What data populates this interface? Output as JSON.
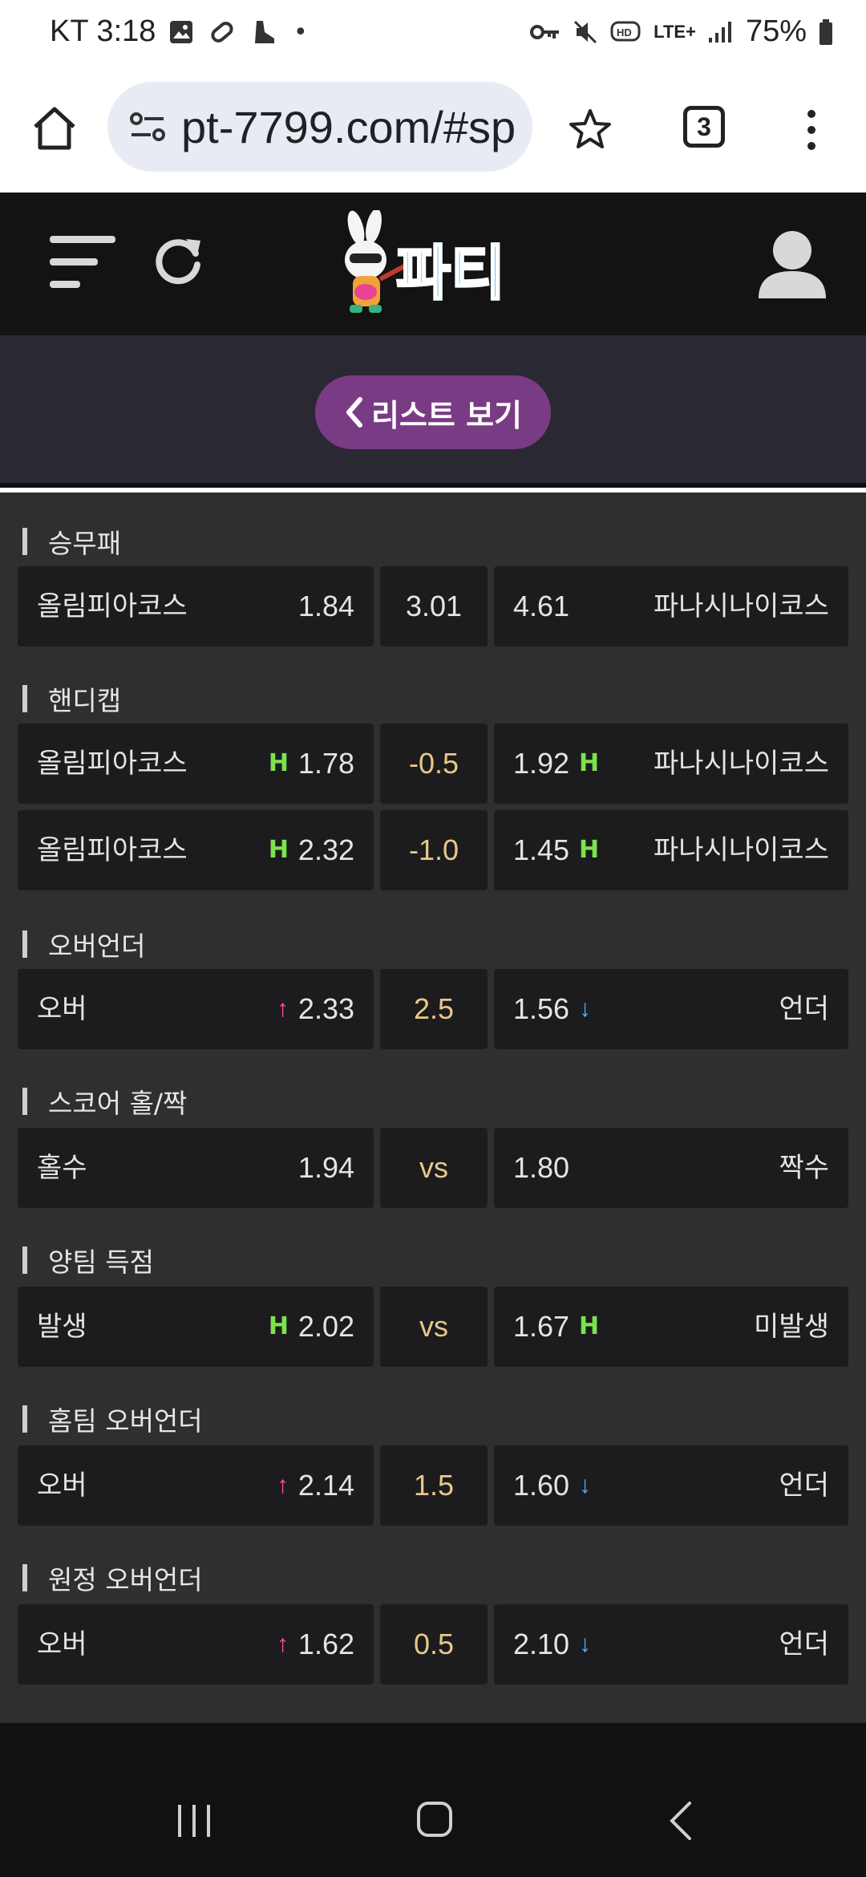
{
  "status_bar": {
    "carrier_time": "KT 3:18",
    "dot": "•",
    "network": "LTE+",
    "battery": "75%"
  },
  "browser": {
    "url": "pt-7799.com/#sp",
    "tab_count": "3"
  },
  "site": {
    "logo_text": "파티",
    "list_button": "리스트 보기"
  },
  "sections": [
    {
      "title": "승무패",
      "rows": [
        {
          "home_team": "올림피아코스",
          "home_mark": "",
          "home_odds": "1.84",
          "mid": "3.01",
          "away_odds": "4.61",
          "away_mark": "",
          "away_team": "파나시나이코스"
        }
      ]
    },
    {
      "title": "핸디캡",
      "rows": [
        {
          "home_team": "올림피아코스",
          "home_mark": "H",
          "home_odds": "1.78",
          "mid": "-0.5",
          "away_odds": "1.92",
          "away_mark": "H",
          "away_team": "파나시나이코스"
        },
        {
          "home_team": "올림피아코스",
          "home_mark": "H",
          "home_odds": "2.32",
          "mid": "-1.0",
          "away_odds": "1.45",
          "away_mark": "H",
          "away_team": "파나시나이코스"
        }
      ]
    },
    {
      "title": "오버언더",
      "rows": [
        {
          "home_team": "오버",
          "home_mark": "↑",
          "home_odds": "2.33",
          "mid": "2.5",
          "away_odds": "1.56",
          "away_mark": "↓",
          "away_team": "언더"
        }
      ]
    },
    {
      "title": "스코어 홀/짝",
      "rows": [
        {
          "home_team": "홀수",
          "home_mark": "",
          "home_odds": "1.94",
          "mid": "vs",
          "away_odds": "1.80",
          "away_mark": "",
          "away_team": "짝수"
        }
      ]
    },
    {
      "title": "양팀 득점",
      "rows": [
        {
          "home_team": "발생",
          "home_mark": "H",
          "home_odds": "2.02",
          "mid": "vs",
          "away_odds": "1.67",
          "away_mark": "H",
          "away_team": "미발생"
        }
      ]
    },
    {
      "title": "홈팀 오버언더",
      "rows": [
        {
          "home_team": "오버",
          "home_mark": "↑",
          "home_odds": "2.14",
          "mid": "1.5",
          "away_odds": "1.60",
          "away_mark": "↓",
          "away_team": "언더"
        }
      ]
    },
    {
      "title": "원정 오버언더",
      "rows": [
        {
          "home_team": "오버",
          "home_mark": "↑",
          "home_odds": "1.62",
          "mid": "0.5",
          "away_odds": "2.10",
          "away_mark": "↓",
          "away_team": "언더"
        }
      ]
    }
  ],
  "colors": {
    "handicap_mark": "#7de34c",
    "up_arrow": "#ff4f9a",
    "down_arrow": "#4db3ff",
    "line_value": "#e8c887",
    "list_button_bg": "#7a3b85"
  }
}
